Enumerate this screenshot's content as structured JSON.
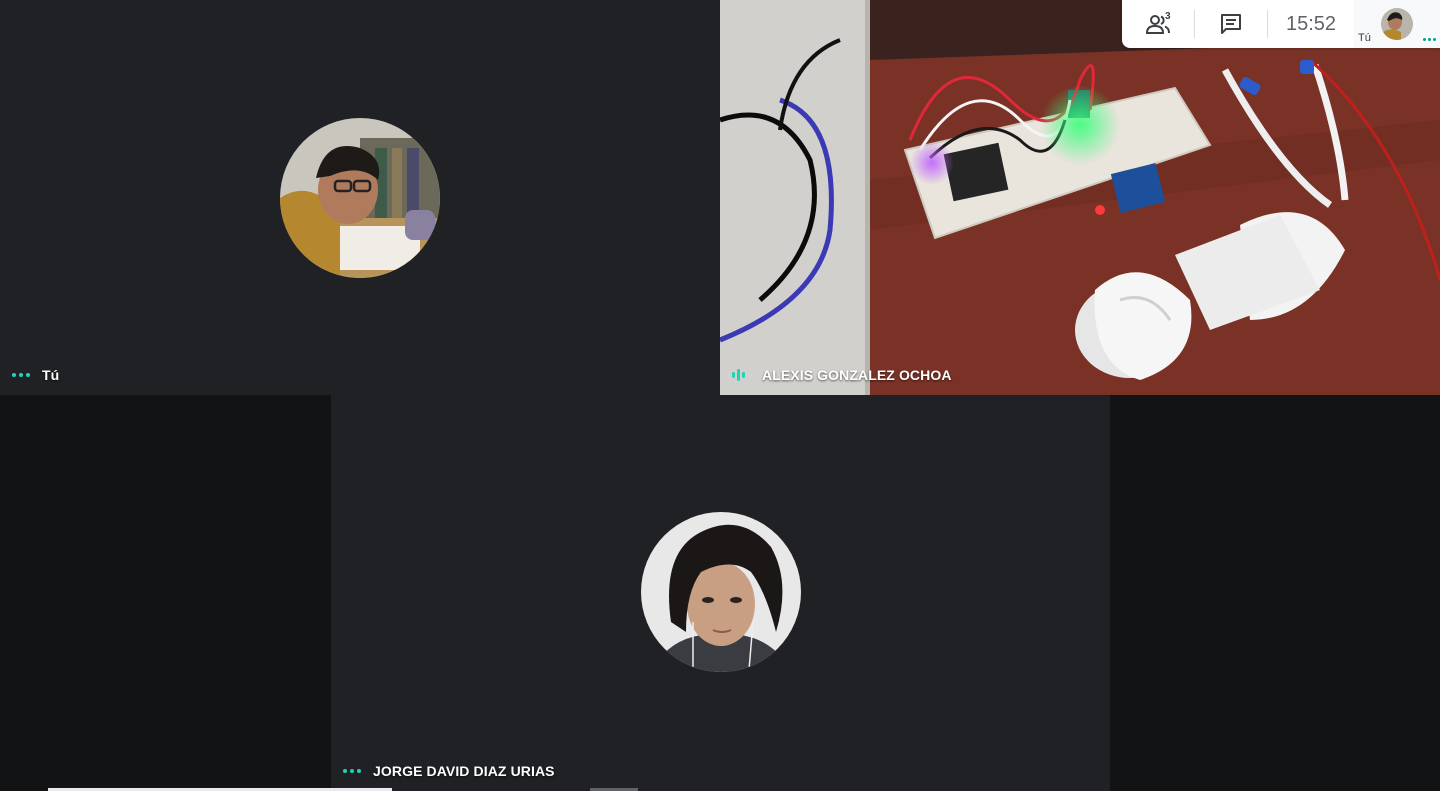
{
  "topbar": {
    "participants_count": "3",
    "time": "15:52",
    "self_label": "Tú"
  },
  "tiles": {
    "self": {
      "name": "Tú"
    },
    "presenter": {
      "name": "ALEXIS GONZALEZ OCHOA"
    },
    "jorge": {
      "name": "JORGE DAVID DIAZ URIAS"
    }
  },
  "icons": {
    "participants": "people-icon",
    "chat": "chat-icon",
    "more": "more-dots-icon",
    "audio": "audio-level-icon"
  },
  "colors": {
    "tile_bg": "#202124",
    "accent": "#1fd3b6",
    "topbar_bg": "#ffffff"
  }
}
